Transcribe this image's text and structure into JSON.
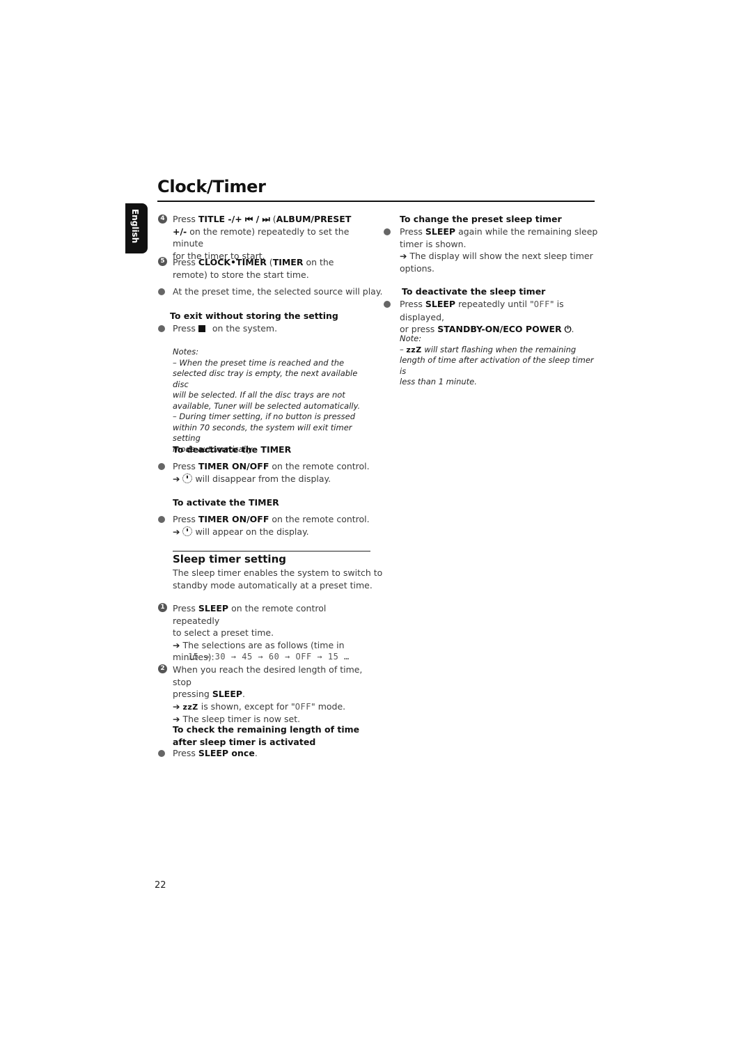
{
  "page": {
    "title": "Clock/Timer",
    "language_tab": "English",
    "page_number": "22"
  },
  "left": {
    "step4": {
      "num": "4",
      "pre": "Press ",
      "b1": "TITLE -/+ ⏮ / ⏭",
      "mid": " (",
      "b2": "ALBUM/PRESET",
      "line2_b": "+/-",
      "line2": "  on the remote) repeatedly to set the minute",
      "line3": "for the timer to start."
    },
    "step5": {
      "num": "5",
      "pre": "Press ",
      "b1": "CLOCK•TIMER",
      "mid": " (",
      "b2": "TIMER",
      "post": "  on the",
      "line2": "remote) to store the start time."
    },
    "bullet_preset": "At the preset time, the selected source will play.",
    "exit_heading": "To exit without storing the setting",
    "exit_pre": "Press",
    "exit_post": " on the system.",
    "notes_label": "Notes:",
    "notes": [
      "–  When the preset time is reached and the",
      "selected disc tray is empty, the next available disc",
      "will be selected.  If all the disc trays are not",
      "available, Tuner will be selected automatically.",
      "–  During timer setting, if no button is pressed",
      "within 70 seconds, the system will exit timer setting",
      "mode automatically."
    ],
    "deactivate_heading": "To deactivate the TIMER",
    "deactivate_pre": "Press ",
    "deactivate_b": "TIMER ON/OFF",
    "deactivate_post": " on the remote control.",
    "deactivate_result": " will disappear from the display.",
    "activate_heading": "To activate the TIMER",
    "activate_pre": "Press ",
    "activate_b": "TIMER ON/OFF",
    "activate_post": " on the remote control.",
    "activate_result": " will appear on the display.",
    "arrow": "➔"
  },
  "sleep": {
    "title": "Sleep timer setting",
    "intro1": "The sleep timer enables the system to switch to",
    "intro2": "standby mode automatically at a preset time.",
    "step1": {
      "num": "1",
      "pre": "Press ",
      "b": "SLEEP",
      "post": " on the remote control repeatedly",
      "line2": "to select a preset time.",
      "line3": " The selections are as follows (time in",
      "line4": "minutes):",
      "sequence": "15 → 30 → 45 → 60 → OFF →  15 …"
    },
    "step2": {
      "num": "2",
      "line1": "When you reach the desired length of time, stop",
      "line2_pre": "pressing ",
      "line2_b": "SLEEP",
      "line2_post": ".",
      "zzz": "zzZ",
      "result1_post": " is shown, except for \"",
      "off": "OFF",
      "result1_end": "\" mode.",
      "result2": " The sleep timer is now set."
    },
    "check_heading1": "To check the remaining length of time",
    "check_heading2": "after sleep timer is activated",
    "check_pre": "Press ",
    "check_b": "SLEEP once",
    "check_post": "."
  },
  "right": {
    "change_heading": "To change the preset sleep timer",
    "change_pre": "Press ",
    "change_b": "SLEEP",
    "change_post": " again while the remaining sleep",
    "change_line2": "timer is shown.",
    "change_line3": " The display will show the next sleep timer",
    "change_line4": "options.",
    "deact_heading": "To deactivate the sleep timer",
    "deact_pre": "Press ",
    "deact_b": "SLEEP",
    "deact_post1": " repeatedly until \"",
    "off": "OFF",
    "deact_post2": "\" is displayed,",
    "deact_line2_pre": "or press ",
    "deact_line2_b": "STANDBY-ON/ECO POWER",
    "deact_power": "⏻",
    "deact_end": ".",
    "note_label": "Note:",
    "note_dash": "– ",
    "note_zzz": "zzZ",
    "note1": " will start flashing when the remaining",
    "note2": "length of time after activation of the sleep timer is",
    "note3": "less than 1 minute."
  }
}
